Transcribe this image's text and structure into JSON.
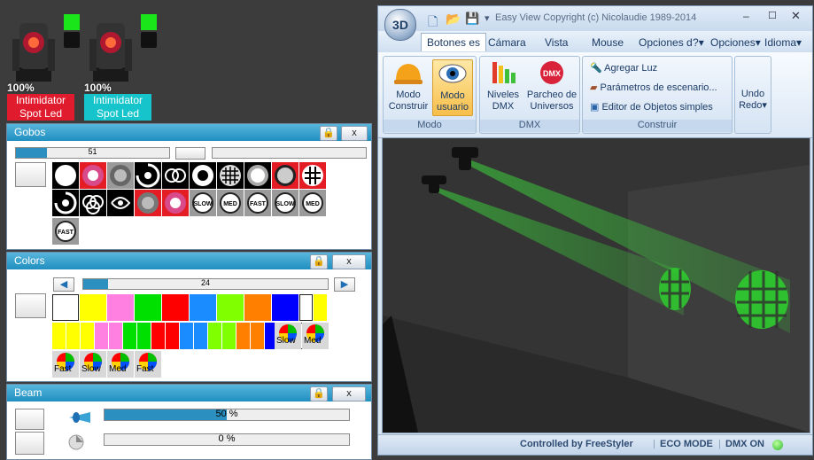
{
  "fixtures": [
    {
      "percent": "100%",
      "label_line1": "Intimidator",
      "label_line2": "Spot Led",
      "label_color": "#e11b2e",
      "indicator_color": "#1ae51a"
    },
    {
      "percent": "100%",
      "label_line1": "Intimidator",
      "label_line2": "Spot Led",
      "label_color": "#16c4cc",
      "indicator_color": "#1ae51a"
    }
  ],
  "gobos_panel": {
    "title": "Gobos",
    "slider_value": "51",
    "slider_fill": 0.2,
    "lock_icon": "lock-icon",
    "close_label": "x",
    "speed_labels": [
      "SLOW",
      "MED",
      "FAST",
      "SLOW",
      "MED",
      "FAST"
    ]
  },
  "colors_panel": {
    "title": "Colors",
    "slider_value": "24",
    "slider_fill": 0.1,
    "close_label": "x",
    "row1_colors": [
      "#ffffff",
      "#ffff00",
      "#ff80e0",
      "#00e000",
      "#ff0000",
      "#1a8cff",
      "#80ff00",
      "#ff8000",
      "#0000ff",
      "#ffffff",
      "#ffff00"
    ],
    "row2_colors": [
      "#ffff00",
      "#ff80e0",
      "#00e000",
      "#ff0000",
      "#1a8cff",
      "#80ff00",
      "#ff8000",
      "#0000ff",
      "#ffffff"
    ],
    "wheel_labels": [
      "Slow",
      "Med",
      "Fast",
      "Slow",
      "Med",
      "Fast"
    ]
  },
  "beam_panel": {
    "title": "Beam",
    "close_label": "x",
    "zoom_value": "50 %",
    "zoom_fill": 0.5,
    "focus_value": "0 %",
    "focus_fill": 0.0
  },
  "app": {
    "title": "Easy View   Copyright (c) Nicolaudie 1989-2014",
    "logo": "3D",
    "tabs": [
      "Botones es",
      "Cámara",
      "Vista",
      "Mouse",
      "Opciones d"
    ],
    "tab_right": [
      "?",
      "Opciones",
      "Idioma"
    ],
    "groups": {
      "modo": {
        "label": "Modo",
        "btn1": [
          "Modo",
          "Construir"
        ],
        "btn2": [
          "Modo",
          "usuario"
        ]
      },
      "dmx": {
        "label": "DMX",
        "btn1": [
          "Niveles",
          "DMX"
        ],
        "btn2": [
          "Parcheo de",
          "Universos"
        ],
        "dmx_badge": "DMX"
      },
      "construir": {
        "label": "Construir",
        "items": [
          "Agregar Luz",
          "Parámetros de escenario...",
          "Editor de Objetos simples"
        ]
      },
      "undo": {
        "label": [
          "Undo",
          "Redo"
        ]
      }
    },
    "status": [
      "Controlled by FreeStyler",
      "ECO MODE",
      "DMX ON"
    ]
  }
}
